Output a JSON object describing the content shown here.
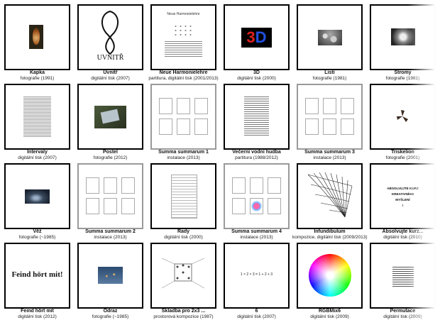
{
  "gallery": {
    "items": [
      {
        "title": "Kapka",
        "subtitle": "fotografie (1991)"
      },
      {
        "title": "Uvnitř",
        "subtitle": "digitální tisk (2007)",
        "thumb_text": "UVNITŘ"
      },
      {
        "title": "Neue Harmonielehre",
        "subtitle": "partitura, digitální tisk (2001/2013)",
        "thumb_text": "Neue Harmonielehre"
      },
      {
        "title": "3D",
        "subtitle": "digitální tisk (2000)",
        "thumb_text_a": "3",
        "thumb_text_b": "D"
      },
      {
        "title": "Listí",
        "subtitle": "fotografie (1981)"
      },
      {
        "title": "Stromy",
        "subtitle": "fotografie (1981)"
      },
      {
        "title": "Intervaly",
        "subtitle": "digitální tisk (2007)"
      },
      {
        "title": "Postel",
        "subtitle": "fotografie (2012)"
      },
      {
        "title": "Summa summarum 1",
        "subtitle": "instalace (2013)"
      },
      {
        "title": "Večerní vodní hudba",
        "subtitle": "partitura (1988/2012)"
      },
      {
        "title": "Summa summarum 3",
        "subtitle": "instalace (2013)"
      },
      {
        "title": "Triskelion",
        "subtitle": "fotografie (2001)"
      },
      {
        "title": "Věž",
        "subtitle": "fotografie (~1985)"
      },
      {
        "title": "Summa summarum 2",
        "subtitle": "instalace (2013)"
      },
      {
        "title": "Řady",
        "subtitle": "digitální tisk (2000)"
      },
      {
        "title": "Summa summarum 4",
        "subtitle": "instalace (2013)"
      },
      {
        "title": "Infundibulum",
        "subtitle": "kompozice, digitální tisk (2009/2013)"
      },
      {
        "title": "Absolvujte kurz...",
        "subtitle": "digitální tisk (2010)",
        "thumb_lines": [
          "ABSOLVUJTE KURZ",
          "KREATIVNÍHO",
          "MYŠLENÍ",
          "!"
        ]
      },
      {
        "title": "Feind hört mit",
        "subtitle": "digitální tisk (2012)",
        "thumb_text": "Feind hört mit!"
      },
      {
        "title": "Odraz",
        "subtitle": "fotografie (~1985)"
      },
      {
        "title": "Skladba pro 2x3 ...",
        "subtitle": "prostorová kompozice (1987)"
      },
      {
        "title": "6",
        "subtitle": "digitální tisk (2007)",
        "thumb_text": "1 × 2 × 3 = 1 + 2 + 3"
      },
      {
        "title": "RGBMix6",
        "subtitle": "digitální tisk (2009)"
      },
      {
        "title": "Permutace",
        "subtitle": "digitální tisk (2009)"
      }
    ]
  }
}
